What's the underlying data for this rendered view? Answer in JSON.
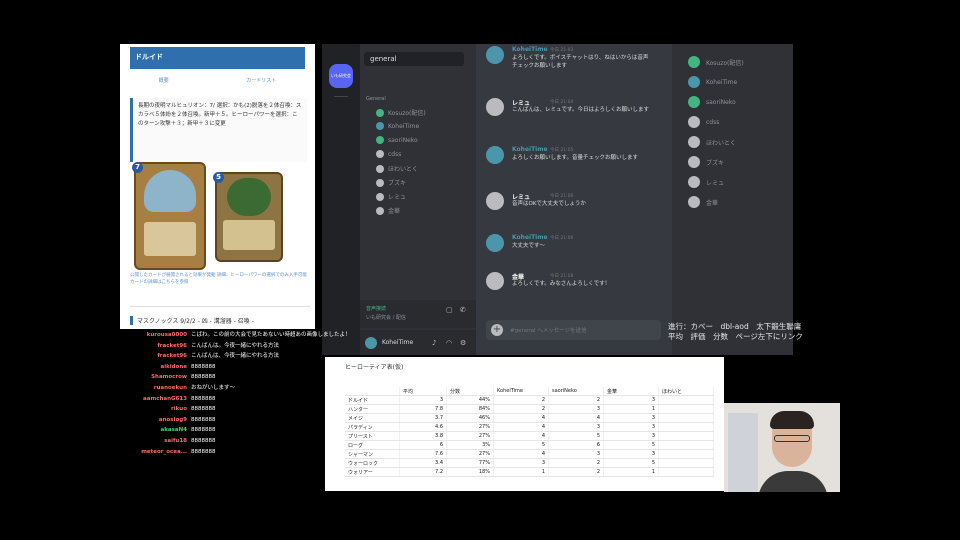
{
  "guide": {
    "header": "ドルイド",
    "tabs": [
      "概要",
      "カードリスト"
    ],
    "note": "長期の夜明マルヒュリオン：7/ 選択：かも(2)脱落を２体召喚：スカラベ５体紛を２体召喚。新甲＋５。ヒーローパワーを選択：このターン攻撃＋３；新甲＋３に変更",
    "card1_cost": "7",
    "card2_cost": "5",
    "small_text": "公開したカードが展開されると効果が発動 詳細、ヒーローパワーの選択でのみ入手可能 カードの詳細はこちらを参照",
    "bottom_text": "マスクノックス 9/2/2 - 凶 - 溝溜器 - 召喚 -"
  },
  "discord": {
    "server_label": "いも研究会",
    "channel_search": "general",
    "category_label": "General",
    "voice_users": [
      {
        "name": "Kosuzo(配信)",
        "color": "#43b581"
      },
      {
        "name": "KoheiTime",
        "color": "#4b96ab"
      },
      {
        "name": "saoriNeko",
        "color": "#43b581"
      },
      {
        "name": "cdss",
        "color": "#b9bbbe"
      },
      {
        "name": "ほわいとく",
        "color": "#b9bbbe"
      },
      {
        "name": "ブズキ",
        "color": "#b9bbbe"
      },
      {
        "name": "レミュ",
        "color": "#b9bbbe"
      },
      {
        "name": "金華",
        "color": "#b9bbbe"
      }
    ],
    "voice_status": "音声接続",
    "voice_sub": "いも研究会 / 配信",
    "self_name": "KoheiTime",
    "messages": [
      {
        "name": "KoheiTime",
        "name_color": "#4b96ab",
        "avatar_color": "#4b96ab",
        "time": "今日 21:03",
        "text": "よろしくです。ボイスチャットはり、ねはいからは音声チェックお願いします"
      },
      {
        "name": "レミュ",
        "name_color": "#ffffff",
        "avatar_color": "#b9bbbe",
        "time": "今日 21:04",
        "text": "こんばんは、レミュです。今日はよろしくお願いします"
      },
      {
        "name": "KoheiTime",
        "name_color": "#4b96ab",
        "avatar_color": "#4b96ab",
        "time": "今日 21:05",
        "text": "よろしくお願いします。音量チェックお願いします"
      },
      {
        "name": "レミュ",
        "name_color": "#ffffff",
        "avatar_color": "#b9bbbe",
        "time": "今日 21:06",
        "text": "音声はOKで大丈夫でしょうか"
      },
      {
        "name": "KoheiTime",
        "name_color": "#4b96ab",
        "avatar_color": "#4b96ab",
        "time": "今日 21:06",
        "text": "大丈夫です〜"
      },
      {
        "name": "金華",
        "name_color": "#ffffff",
        "avatar_color": "#b9bbbe",
        "time": "今日 21:08",
        "text": "よろしくです。みなさんよろしくです！"
      }
    ],
    "composer_placeholder": "#general へメッセージを送信",
    "members": [
      {
        "name": "Kosuzo(配信)",
        "color": "#43b581"
      },
      {
        "name": "KoheiTime",
        "color": "#4b96ab"
      },
      {
        "name": "saoriNeko",
        "color": "#43b581"
      },
      {
        "name": "cdss",
        "color": "#b9bbbe"
      },
      {
        "name": "ほわいとく",
        "color": "#b9bbbe"
      },
      {
        "name": "ブズキ",
        "color": "#b9bbbe"
      },
      {
        "name": "レミュ",
        "color": "#b9bbbe"
      },
      {
        "name": "金華",
        "color": "#b9bbbe"
      }
    ]
  },
  "chatlog": [
    {
      "user": "kurousa0000",
      "color": "#ff6a6a",
      "text": "こばわ。この前の大会で見たあないい時超あの画像しましたよ！"
    },
    {
      "user": "fracket96",
      "color": "#ff6a6a",
      "text": "こんばんは。今夜一緒にやれる方法"
    },
    {
      "user": "fracket96",
      "color": "#ff6a6a",
      "text": "こんばんは、今夜一緒にやれる方法"
    },
    {
      "user": "aikidone",
      "color": "#ff6a6a",
      "text": "8888888"
    },
    {
      "user": "Shamocrow",
      "color": "#ff6a6a",
      "text": "8888888"
    },
    {
      "user": "ruanoekun",
      "color": "#ff6a6a",
      "text": "おねがいします～"
    },
    {
      "user": "aamchanG613",
      "color": "#ff6a6a",
      "text": "8888888"
    },
    {
      "user": "rikuo",
      "color": "#ff6a6a",
      "text": "8888888"
    },
    {
      "user": "anoslog9",
      "color": "#ff6a6a",
      "text": "8888888"
    },
    {
      "user": "akasaN4",
      "color": "#43d36b",
      "text": "8888888"
    },
    {
      "user": "saifu18",
      "color": "#ff6a6a",
      "text": "8888888"
    },
    {
      "user": "meteor_ocea...",
      "color": "#ff6a6a",
      "text": "8888888"
    }
  ],
  "overlay_lines": [
    "進行：カベー　dbl-aod　太下鍛生聯庸",
    "平均　評価　分数　ページ左下にリンク"
  ],
  "sheet": {
    "title": "ヒーローティア表(仮)",
    "headers": [
      "",
      "平均",
      "分数",
      "KoheiTime",
      "saoriNeko",
      "金華",
      "ほわいと"
    ],
    "rows": [
      [
        "ドルイド",
        "3",
        "44%",
        "2",
        "2",
        "3"
      ],
      [
        "ハンター",
        "7.8",
        "84%",
        "2",
        "3",
        "1"
      ],
      [
        "メイジ",
        "3.7",
        "46%",
        "4",
        "4",
        "3"
      ],
      [
        "パラディン",
        "4.6",
        "27%",
        "4",
        "3",
        "3"
      ],
      [
        "プリースト",
        "3.8",
        "27%",
        "4",
        "5",
        "3"
      ],
      [
        "ローグ",
        "6",
        "3%",
        "5",
        "6",
        "5"
      ],
      [
        "シャーマン",
        "7.6",
        "27%",
        "4",
        "3",
        "3"
      ],
      [
        "ウォーロック",
        "3.4",
        "77%",
        "3",
        "2",
        "5"
      ],
      [
        "ウォリアー",
        "7.2",
        "18%",
        "1",
        "2",
        "1"
      ]
    ]
  }
}
